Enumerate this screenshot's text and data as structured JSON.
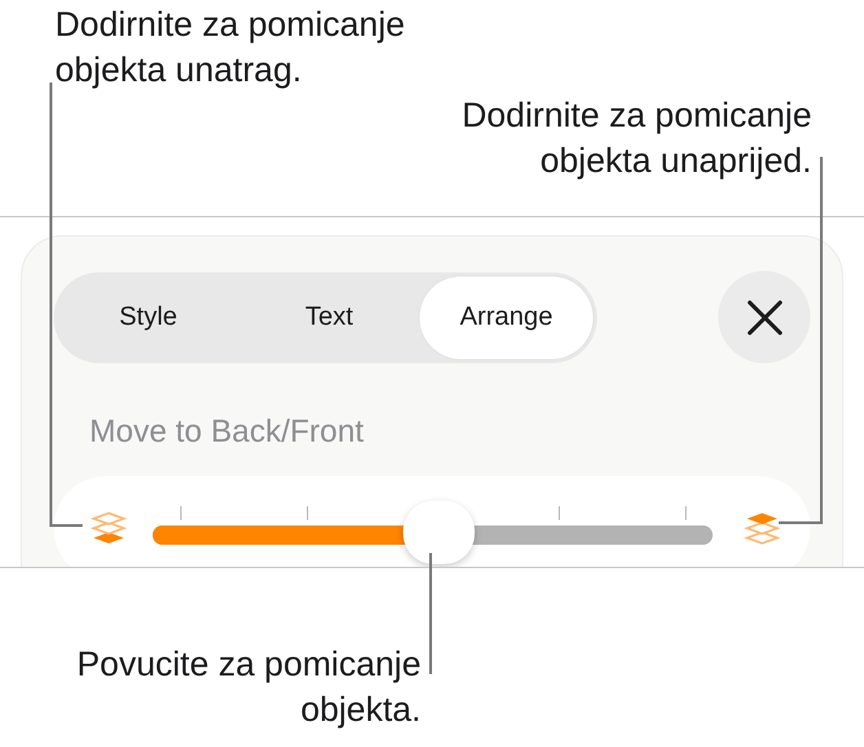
{
  "callouts": [
    {
      "text": "Dodirnite za pomicanje objekta unatrag."
    },
    {
      "text": "Dodirnite za pomicanje objekta unaprijed."
    },
    {
      "text": "Povucite za pomicanje objekta."
    }
  ],
  "tabs": [
    {
      "label": "Style",
      "selected": false
    },
    {
      "label": "Text",
      "selected": false
    },
    {
      "label": "Arrange",
      "selected": true
    }
  ],
  "section_title": "Move to Back/Front",
  "slider": {
    "level": 0.51
  }
}
